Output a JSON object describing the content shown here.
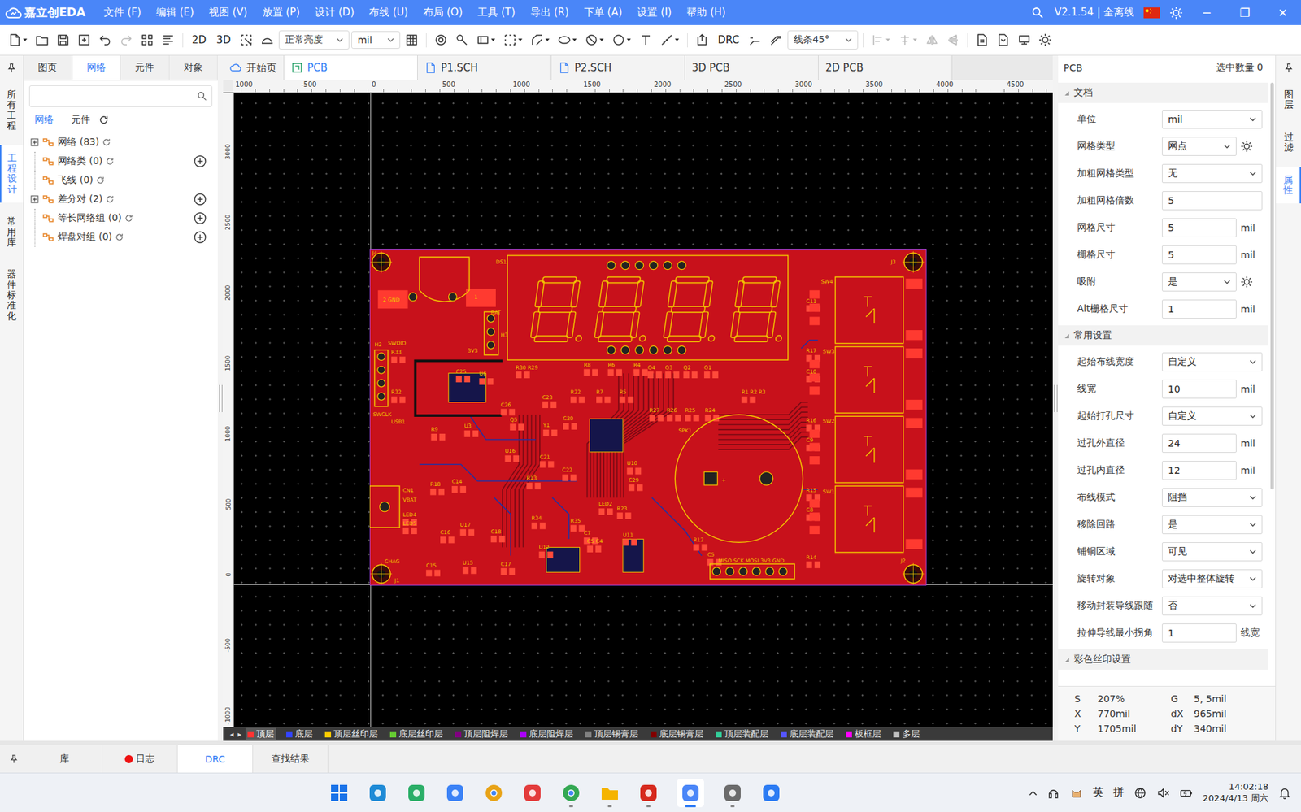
{
  "titleBar": {
    "appName": "嘉立创EDA",
    "menus": [
      "文件 (F)",
      "编辑 (E)",
      "视图 (V)",
      "放置 (P)",
      "设计 (D)",
      "布线 (U)",
      "布局 (O)",
      "工具 (T)",
      "导出 (R)",
      "下单 (A)",
      "设置 (I)",
      "帮助 (H)"
    ],
    "version": "V2.1.54 | 全离线",
    "controls": [
      "─",
      "❐",
      "✕"
    ]
  },
  "toolbar": {
    "view2d": "2D",
    "view3d": "3D",
    "brightness": "正常亮度",
    "unit": "mil",
    "drc": "DRC",
    "lineAngle": "线条45°",
    "icons": [
      {
        "disabled": false
      },
      {
        "disabled": false
      },
      {
        "disabled": false
      },
      {
        "disabled": false
      },
      {
        "disabled": false
      },
      {
        "disabled": true
      },
      {
        "disabled": false
      },
      {
        "disabled": false
      },
      {
        "disabled": false
      },
      {
        "disabled": false
      },
      {
        "disabled": false
      },
      {
        "disabled": false
      },
      {
        "disabled": false
      },
      {
        "disabled": false
      },
      {
        "disabled": false
      },
      {
        "disabled": false
      },
      {
        "disabled": false
      },
      {
        "disabled": false
      },
      {
        "disabled": false
      },
      {
        "disabled": false
      },
      {
        "disabled": false
      },
      {
        "disabled": false
      },
      {
        "disabled": false
      },
      {
        "disabled": false
      },
      {
        "disabled": true
      },
      {
        "disabled": true
      },
      {
        "disabled": true
      },
      {
        "disabled": true
      },
      {
        "disabled": false
      },
      {
        "disabled": false
      },
      {
        "disabled": false
      },
      {
        "disabled": false
      }
    ]
  },
  "leftStrip": [
    {
      "label": "所有工程",
      "selected": false
    },
    {
      "label": "工程设计",
      "selected": true
    },
    {
      "label": "常用库",
      "selected": false
    },
    {
      "label": "器件标准化",
      "selected": false
    }
  ],
  "leftPanel": {
    "tabs": [
      {
        "label": "图页",
        "selected": false
      },
      {
        "label": "网络",
        "selected": true
      },
      {
        "label": "元件",
        "selected": false
      },
      {
        "label": "对象",
        "selected": false
      }
    ],
    "subTabs": [
      {
        "label": "网络",
        "selected": true
      },
      {
        "label": "元件",
        "selected": false
      }
    ],
    "tree": [
      {
        "label": "网络 (83)",
        "expandable": true,
        "addable": false
      },
      {
        "label": "网络类 (0)",
        "expandable": false,
        "addable": true
      },
      {
        "label": "飞线 (0)",
        "expandable": false,
        "addable": false
      },
      {
        "label": "差分对 (2)",
        "expandable": true,
        "addable": true
      },
      {
        "label": "等长网络组 (0)",
        "expandable": false,
        "addable": true
      },
      {
        "label": "焊盘对组 (0)",
        "expandable": false,
        "addable": true
      }
    ]
  },
  "docTabs": [
    {
      "label": "开始页",
      "selected": false,
      "kind": "home"
    },
    {
      "label": "PCB",
      "selected": true,
      "kind": "pcb"
    },
    {
      "label": "P1.SCH",
      "selected": false,
      "kind": "sch"
    },
    {
      "label": "P2.SCH",
      "selected": false,
      "kind": "sch"
    },
    {
      "label": "3D PCB",
      "selected": false,
      "kind": "view"
    },
    {
      "label": "2D PCB",
      "selected": false,
      "kind": "view"
    }
  ],
  "rulers": {
    "top": [
      "1000",
      "-500",
      "0",
      "500",
      "1000",
      "1500",
      "2000",
      "2500",
      "3000",
      "3500",
      "4000",
      "4500"
    ],
    "left": [
      "3000",
      "2500",
      "2000",
      "1500",
      "1000",
      "500",
      "0",
      "-500",
      "-1000"
    ]
  },
  "pcb": {
    "labels": [
      "J4",
      "J3",
      "J1",
      "J2",
      "DS1",
      "BAT",
      "3V3",
      "H3",
      "2 GND",
      "1",
      "SW4",
      "SW3",
      "SW2",
      "SW1",
      "C11",
      "C10",
      "C9",
      "C8",
      "R17",
      "R16",
      "R15",
      "R14",
      "SPK1",
      "+",
      "H2",
      "SWDIO",
      "SWCLK",
      "R33",
      "R32",
      "USB1",
      "R9",
      "U3",
      "U6",
      "C25",
      "C26",
      "R30 R29",
      "R8",
      "R6",
      "R4",
      "Q4",
      "Q3",
      "Q2",
      "Q1",
      "R1 R2 R3",
      "R22",
      "R7",
      "R5",
      "C23",
      "C20",
      "Y1",
      "C21",
      "C22",
      "U16",
      "U10",
      "C29",
      "LED2",
      "R23",
      "R34",
      "R35",
      "CN1",
      "VBAT",
      "LED4",
      "LED5",
      "R18",
      "C14",
      "C16",
      "U17",
      "C18",
      "C15",
      "CHAG",
      "U15",
      "C17",
      "U12",
      "C7",
      "C5 C4",
      "U11",
      "R12",
      "C5",
      "MISO SCK MOSI 3V3 GND",
      "R13",
      "Q5",
      "R27",
      "R26",
      "R25",
      "R24"
    ]
  },
  "layers": {
    "nav": [
      "◂",
      "▸"
    ],
    "items": [
      {
        "label": "顶层",
        "selected": true,
        "color": "#ff3333"
      },
      {
        "label": "底层",
        "selected": false,
        "color": "#3344ff"
      },
      {
        "label": "顶层丝印层",
        "selected": false,
        "color": "#ffcc00"
      },
      {
        "label": "底层丝印层",
        "selected": false,
        "color": "#66cc33"
      },
      {
        "label": "顶层阻焊层",
        "selected": false,
        "color": "#800080"
      },
      {
        "label": "底层阻焊层",
        "selected": false,
        "color": "#aa00ff"
      },
      {
        "label": "顶层锡膏层",
        "selected": false,
        "color": "#808080"
      },
      {
        "label": "底层锡膏层",
        "selected": false,
        "color": "#800000"
      },
      {
        "label": "顶层装配层",
        "selected": false,
        "color": "#33cc99"
      },
      {
        "label": "底层装配层",
        "selected": false,
        "color": "#5555ff"
      },
      {
        "label": "板框层",
        "selected": false,
        "color": "#ff00ff"
      },
      {
        "label": "多层",
        "selected": false,
        "color": "#c0c0c0"
      }
    ]
  },
  "rightPanel": {
    "header": "PCB",
    "selection": "选中数量 0",
    "sections": [
      {
        "title": "文档",
        "expanded": true,
        "rows": [
          {
            "label": "单位",
            "value": "mil",
            "kind": "select"
          },
          {
            "label": "网格类型",
            "value": "网点",
            "kind": "select",
            "settings": true
          },
          {
            "label": "加粗网格类型",
            "value": "无",
            "kind": "select"
          },
          {
            "label": "加粗网格倍数",
            "value": "5",
            "kind": "input"
          },
          {
            "label": "网格尺寸",
            "value": "5",
            "kind": "input",
            "unit": "mil"
          },
          {
            "label": "栅格尺寸",
            "value": "5",
            "kind": "input",
            "unit": "mil"
          },
          {
            "label": "吸附",
            "value": "是",
            "kind": "select",
            "settings": true
          },
          {
            "label": "Alt栅格尺寸",
            "value": "1",
            "kind": "input",
            "unit": "mil"
          }
        ]
      },
      {
        "title": "常用设置",
        "expanded": true,
        "rows": [
          {
            "label": "起始布线宽度",
            "value": "自定义",
            "kind": "select"
          },
          {
            "label": "线宽",
            "value": "10",
            "kind": "input",
            "unit": "mil"
          },
          {
            "label": "起始打孔尺寸",
            "value": "自定义",
            "kind": "select"
          },
          {
            "label": "过孔外直径",
            "value": "24",
            "kind": "input",
            "unit": "mil"
          },
          {
            "label": "过孔内直径",
            "value": "12",
            "kind": "input",
            "unit": "mil"
          },
          {
            "label": "布线模式",
            "value": "阻挡",
            "kind": "select"
          },
          {
            "label": "移除回路",
            "value": "是",
            "kind": "select"
          },
          {
            "label": "铺铜区域",
            "value": "可见",
            "kind": "select"
          },
          {
            "label": "旋转对象",
            "value": "对选中整体旋转",
            "kind": "select"
          },
          {
            "label": "移动封装导线跟随",
            "value": "否",
            "kind": "select"
          },
          {
            "label": "拉伸导线最小拐角",
            "value": "1",
            "kind": "input",
            "unit": "线宽"
          }
        ]
      },
      {
        "title": "彩色丝印设置",
        "expanded": true,
        "rows": []
      }
    ],
    "status": [
      {
        "key": "S",
        "value": "207%"
      },
      {
        "key": "G",
        "value": "5, 5mil"
      },
      {
        "key": "X",
        "value": "770mil"
      },
      {
        "key": "dX",
        "value": "965mil"
      },
      {
        "key": "Y",
        "value": "1705mil"
      },
      {
        "key": "dY",
        "value": "340mil"
      }
    ]
  },
  "rightStrip": [
    {
      "label": "图层",
      "selected": false
    },
    {
      "label": "过滤",
      "selected": false
    },
    {
      "label": "属性",
      "selected": true
    }
  ],
  "bottomTabs": [
    {
      "label": "库",
      "selected": false,
      "alert": false
    },
    {
      "label": "日志",
      "selected": false,
      "alert": true
    },
    {
      "label": "DRC",
      "selected": true,
      "alert": false
    },
    {
      "label": "查找结果",
      "selected": false,
      "alert": false
    }
  ],
  "taskbar": {
    "apps": [
      {
        "color": "#1a73e8",
        "running": false,
        "active": false
      },
      {
        "color": "#1e8ad6",
        "running": false,
        "active": false
      },
      {
        "color": "#2aae67",
        "running": false,
        "active": false
      },
      {
        "color": "#3b82f6",
        "running": false,
        "active": false
      },
      {
        "color": "#e8a317",
        "running": false,
        "active": false
      },
      {
        "color": "#e33c3c",
        "running": false,
        "active": false
      },
      {
        "color": "#34a853",
        "running": true,
        "active": false
      },
      {
        "color": "#f5b400",
        "running": true,
        "active": false
      },
      {
        "color": "#d62a1e",
        "running": true,
        "active": false
      },
      {
        "color": "#4a86f8",
        "running": true,
        "active": true
      },
      {
        "color": "#6b6b6b",
        "running": true,
        "active": false
      },
      {
        "color": "#2b7bf3",
        "running": false,
        "active": false
      }
    ],
    "ime": [
      "英",
      "拼"
    ],
    "time": "14:02:18",
    "date": "2024/4/13 周六"
  }
}
